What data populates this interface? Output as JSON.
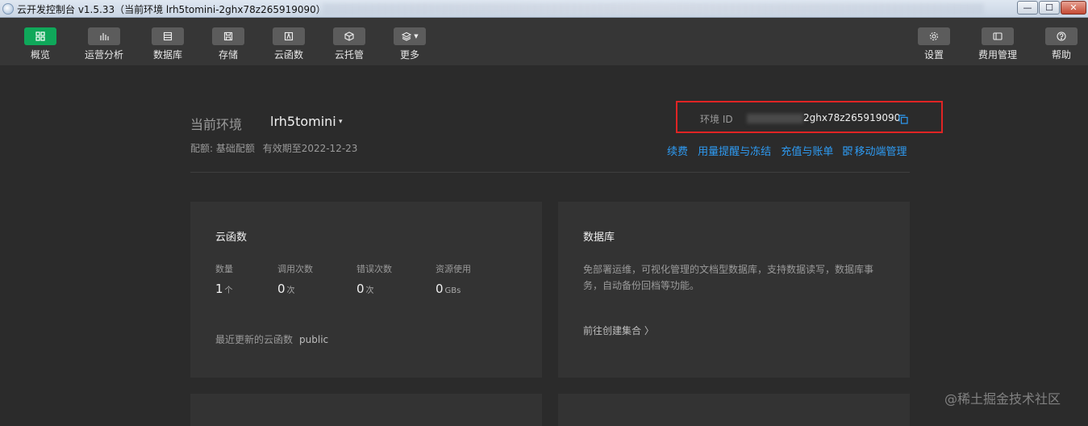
{
  "window": {
    "title": "云开发控制台 v1.5.33（当前环境 lrh5tomini-2ghx78z265919090）",
    "minimize_glyph": "—",
    "maximize_glyph": "☐",
    "close_glyph": "✕"
  },
  "toolbar": {
    "left": [
      {
        "label": "概览",
        "icon": "grid-icon",
        "active": true
      },
      {
        "label": "运营分析",
        "icon": "bar-chart-icon",
        "active": false
      },
      {
        "label": "数据库",
        "icon": "database-icon",
        "active": false
      },
      {
        "label": "存储",
        "icon": "save-icon",
        "active": false
      },
      {
        "label": "云函数",
        "icon": "function-icon",
        "active": false
      },
      {
        "label": "云托管",
        "icon": "cube-icon",
        "active": false
      },
      {
        "label": "更多",
        "icon": "layers-dropdown-icon",
        "active": false
      }
    ],
    "right": [
      {
        "label": "设置",
        "icon": "gear-icon"
      },
      {
        "label": "费用管理",
        "icon": "billing-icon"
      },
      {
        "label": "帮助",
        "icon": "help-icon"
      }
    ],
    "accent_color": "#0fa85a"
  },
  "environment": {
    "label": "当前环境",
    "name": "lrh5tomini",
    "caret": "▾",
    "quota_text": "配额: 基础配额",
    "expiry_text": "有效期至2022-12-23",
    "env_id_label": "环境 ID",
    "env_id_value": "2ghx78z265919090",
    "highlight_color": "#e02424"
  },
  "links": {
    "renew": "续费",
    "usage_alert": "用量提醒与冻结",
    "recharge": "充值与账单",
    "mobile": "移动端管理",
    "link_color": "#2e9bf3"
  },
  "cloud_functions_card": {
    "title": "云函数",
    "stats": [
      {
        "label": "数量",
        "value": "1",
        "unit": "个"
      },
      {
        "label": "调用次数",
        "value": "0",
        "unit": "次"
      },
      {
        "label": "错误次数",
        "value": "0",
        "unit": "次"
      },
      {
        "label": "资源使用",
        "value": "0",
        "unit": "GBs"
      }
    ],
    "recent_label": "最近更新的云函数",
    "recent_function": "public"
  },
  "database_card": {
    "title": "数据库",
    "description": "免部署运维，可视化管理的文档型数据库，支持数据读写，数据库事务，自动备份回档等功能。",
    "action": "前往创建集合 〉"
  },
  "watermark": "@稀土掘金技术社区"
}
